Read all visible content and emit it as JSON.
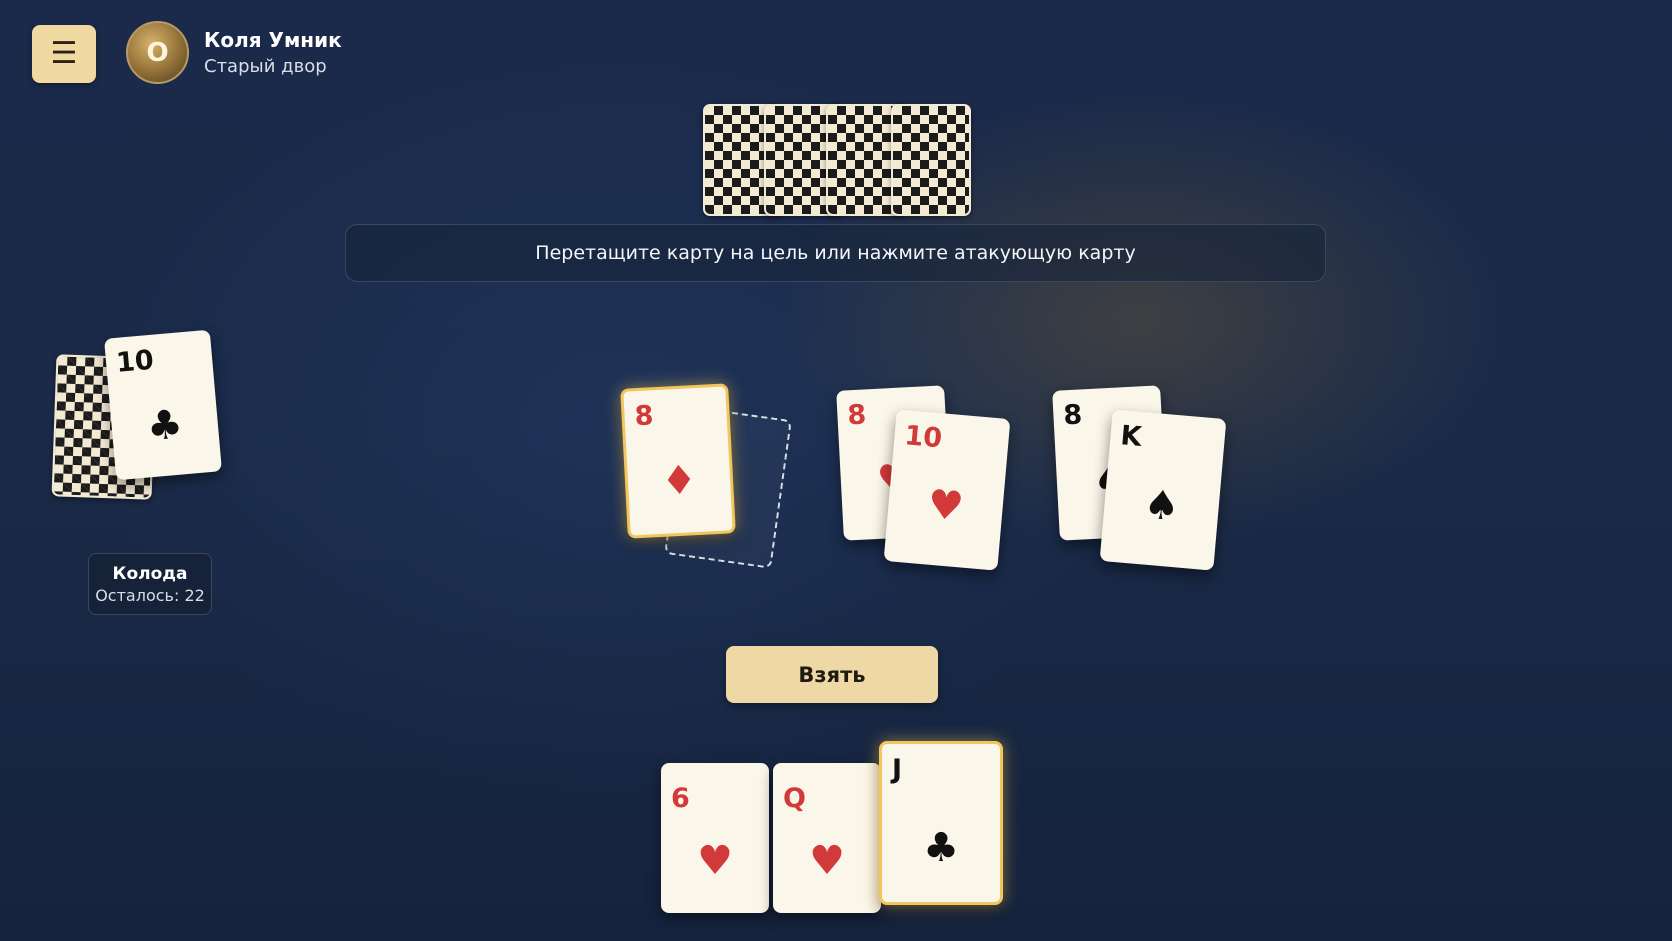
{
  "header": {
    "menu_icon": "☰",
    "avatar_letter": "O",
    "player_name": "Коля Умник",
    "player_location": "Старый двор"
  },
  "hint": "Перетащите карту на цель или нажмите атакующую карту",
  "opponent": {
    "card_backs_count": 4
  },
  "deck": {
    "title": "Колода",
    "remaining_text": "Осталось: 22",
    "trump": {
      "rank": "10",
      "suit": "♣"
    }
  },
  "table": {
    "pairs": [
      {
        "attack": {
          "rank": "8",
          "suit": "♦",
          "color": "red"
        },
        "defense": null
      },
      {
        "attack": {
          "rank": "8",
          "suit": "♥",
          "color": "red"
        },
        "defense": {
          "rank": "10",
          "suit": "♥",
          "color": "red"
        }
      },
      {
        "attack": {
          "rank": "8",
          "suit": "♠",
          "color": "black"
        },
        "defense": {
          "rank": "K",
          "suit": "♠",
          "color": "black"
        }
      }
    ]
  },
  "take_button": "Взять",
  "hand": [
    {
      "rank": "6",
      "suit": "♥",
      "color": "red"
    },
    {
      "rank": "Q",
      "suit": "♥",
      "color": "red"
    },
    {
      "rank": "J",
      "suit": "♣",
      "color": "black"
    }
  ],
  "colors": {
    "red": "#d23a3a",
    "black": "#111111",
    "highlight": "#f2c65c",
    "button": "#eed8a6"
  }
}
